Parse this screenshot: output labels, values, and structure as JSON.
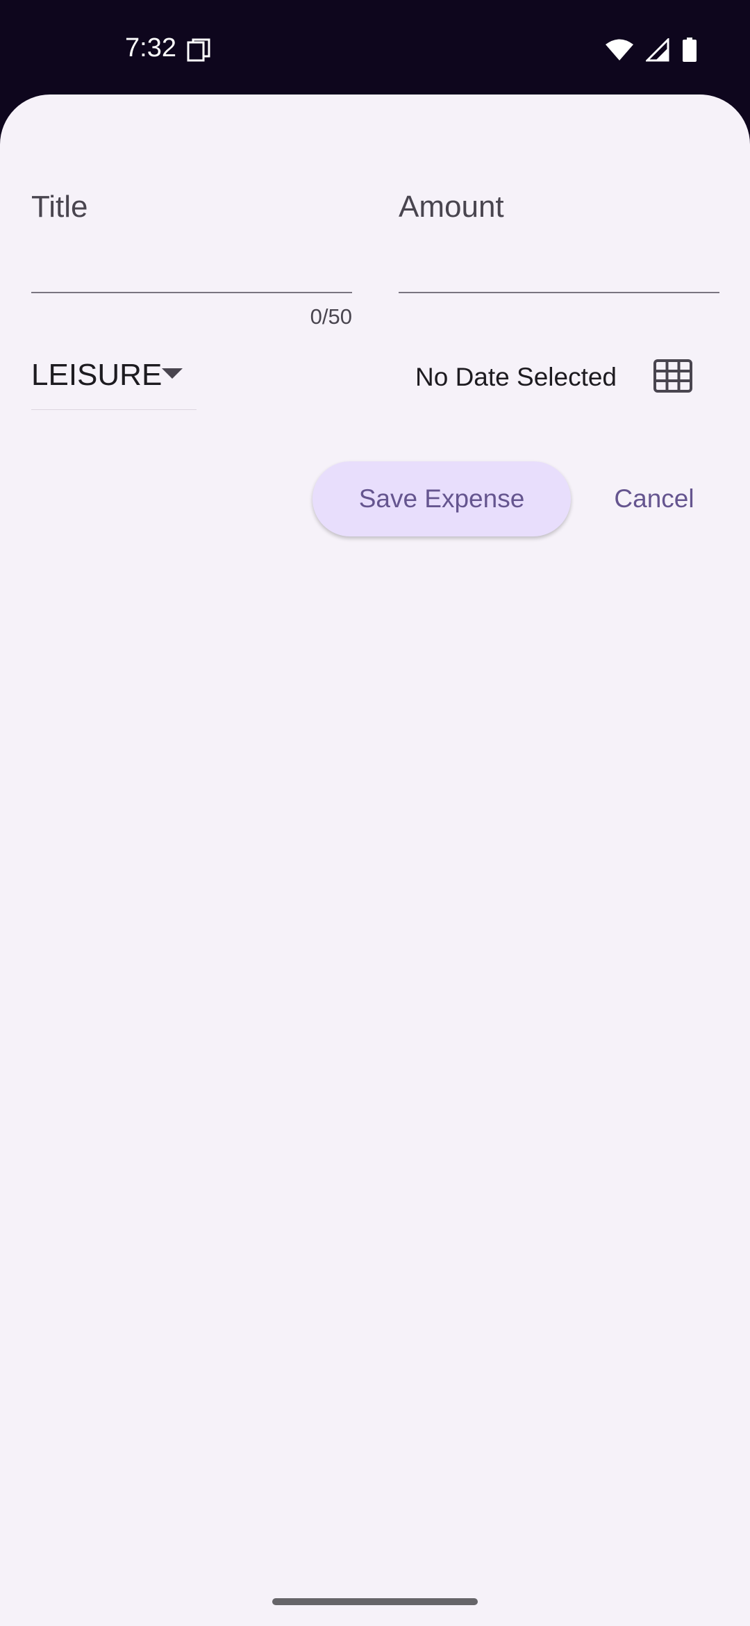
{
  "status_bar": {
    "time": "7:32",
    "left_icon": "screenshot-icon",
    "right_icons": [
      "wifi-icon",
      "cellular-signal-icon",
      "battery-icon"
    ]
  },
  "form": {
    "title_field": {
      "label": "Title",
      "value": "",
      "counter": "0/50"
    },
    "amount_field": {
      "label": "Amount",
      "value": ""
    },
    "category_dropdown": {
      "selected": "LEISURE",
      "icon": "dropdown-arrow-icon"
    },
    "date": {
      "text": "No Date Selected",
      "icon": "calendar-icon"
    },
    "save_button": "Save Expense",
    "cancel_button": "Cancel"
  },
  "colors": {
    "status_bar_bg": "#0e061d",
    "surface": "#f6f2f9",
    "primary": "#65558f",
    "button_container": "#e8defc",
    "on_surface": "#1d1b20",
    "on_surface_variant": "#49454f"
  }
}
